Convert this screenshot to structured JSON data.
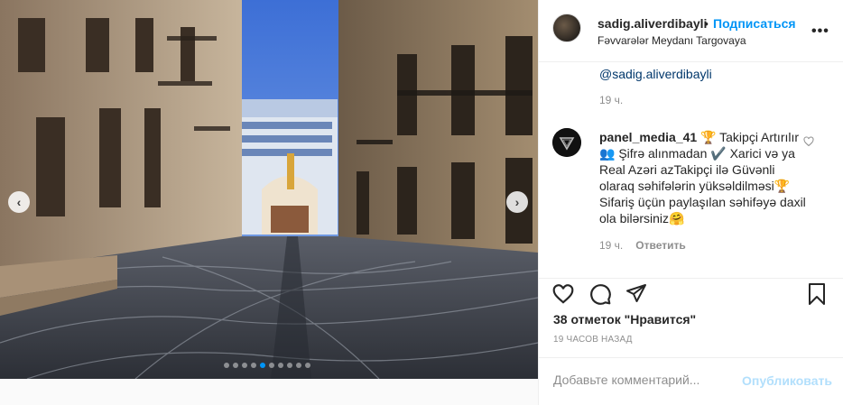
{
  "post": {
    "photo_alt": "",
    "carousel": {
      "total": 10,
      "active": 4
    },
    "nav": {
      "prev_icon": "chevron-left-icon",
      "next_icon": "chevron-right-icon"
    }
  },
  "header": {
    "username": "sadig.aliverdibayli",
    "separator": "•",
    "follow_label": "Подписаться",
    "location": "Fəvvarələr Meydanı Targovaya",
    "more_label": "•••"
  },
  "comments": {
    "previous": {
      "text": "@sadig.aliverdibayli",
      "time": "19 ч."
    },
    "items": [
      {
        "username": "panel_media_41",
        "text": " 🏆 Takipçi Artırılır 👥 Şifrə alınmadan ✔️ Xarici və ya Real Azəri azTakipçi ilə Güvənli olaraq səhifələrin yüksəldilməsi🏆 Sifariş üçün paylaşılan səhifəyə daxil ola bilərsiniz🤗",
        "time": "19 ч.",
        "reply_label": "Ответить"
      }
    ]
  },
  "actions": {
    "likes_text": "38 отметок \"Нравится\"",
    "post_time": "19 ЧАСОВ НАЗАД"
  },
  "add_comment": {
    "placeholder": "Добавьте комментарий...",
    "publish_label": "Опубликовать"
  },
  "colors": {
    "accent": "#0095f6",
    "link": "#00376b",
    "muted": "#8e8e8e",
    "publish_disabled": "#b2dffc"
  }
}
